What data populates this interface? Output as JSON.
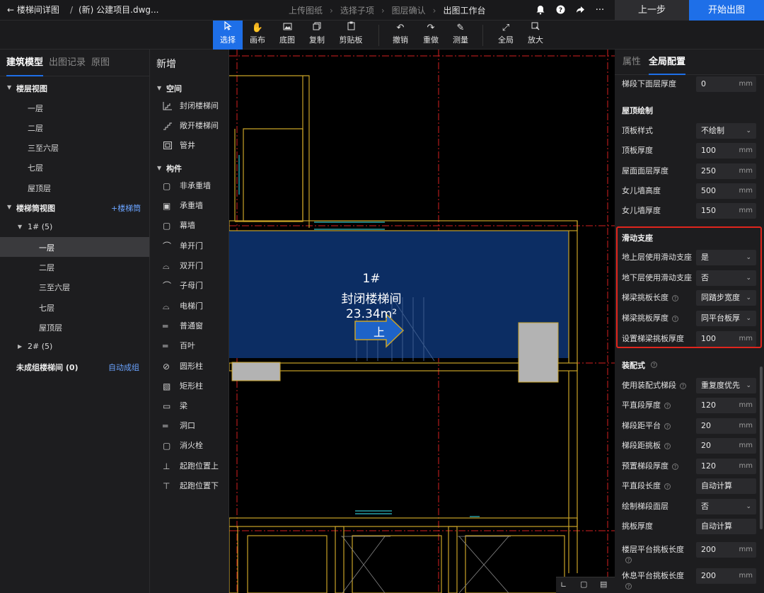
{
  "header": {
    "back_label": "楼梯间详图",
    "file_name": "(新) 公建项目.dwg...",
    "steps": [
      "上传图纸",
      "选择子项",
      "图层确认",
      "出图工作台"
    ],
    "prev_button": "上一步",
    "start_button": "开始出图"
  },
  "toolbar": {
    "tools": [
      {
        "label": "选择",
        "icon": "select-cursor-icon",
        "active": true
      },
      {
        "label": "画布",
        "icon": "hand-icon"
      },
      {
        "label": "底图",
        "icon": "image-icon"
      },
      {
        "label": "复制",
        "icon": "copy-icon"
      },
      {
        "label": "剪贴板",
        "icon": "clipboard-icon"
      },
      {
        "label": "撤销",
        "icon": "undo-icon"
      },
      {
        "label": "重做",
        "icon": "redo-icon"
      },
      {
        "label": "测量",
        "icon": "measure-icon"
      },
      {
        "label": "全局",
        "icon": "fit-all-icon"
      },
      {
        "label": "放大",
        "icon": "zoom-in-icon"
      }
    ]
  },
  "left_panel": {
    "tabs": [
      "建筑模型",
      "出图记录",
      "原图"
    ],
    "floor_view_title": "楼层视图",
    "floors": [
      "一层",
      "二层",
      "三至六层",
      "七层",
      "屋顶层"
    ],
    "stair_view_title": "楼梯筒视图",
    "add_stair": "+楼梯筒",
    "stair1_label": "1# (5)",
    "stair1_floors": [
      "一层",
      "二层",
      "三至六层",
      "七层",
      "屋顶层"
    ],
    "stair2_label": "2# (5)",
    "ungrouped_label": "未成组楼梯间 (0)",
    "auto_group": "自动成组"
  },
  "palette": {
    "title": "新增",
    "space_title": "空间",
    "space_items": [
      "封闭楼梯间",
      "敞开楼梯间",
      "管井"
    ],
    "component_title": "构件",
    "component_items": [
      "非承重墙",
      "承重墙",
      "幕墙",
      "单开门",
      "双开门",
      "子母门",
      "电梯门",
      "普通窗",
      "百叶",
      "圆形柱",
      "矩形柱",
      "梁",
      "洞口",
      "消火栓",
      "起跑位置上",
      "起跑位置下"
    ]
  },
  "canvas": {
    "room_number": "1#",
    "room_name": "封闭楼梯间",
    "room_area": "23.34m²",
    "up_label": "上"
  },
  "right_panel": {
    "tabs": [
      "属性",
      "全局配置"
    ],
    "top_row": {
      "label": "梯段下面层厚度",
      "value": "0",
      "unit": "mm"
    },
    "roof_title": "屋顶绘制",
    "roof_rows": [
      {
        "label": "顶板样式",
        "value": "不绘制",
        "type": "select"
      },
      {
        "label": "顶板厚度",
        "value": "100",
        "unit": "mm"
      },
      {
        "label": "屋面面层厚度",
        "value": "250",
        "unit": "mm"
      },
      {
        "label": "女儿墙高度",
        "value": "500",
        "unit": "mm"
      },
      {
        "label": "女儿墙厚度",
        "value": "150",
        "unit": "mm"
      }
    ],
    "slide_title": "滑动支座",
    "slide_rows": [
      {
        "label": "地上层使用滑动支座",
        "value": "是",
        "type": "select"
      },
      {
        "label": "地下层使用滑动支座",
        "value": "否",
        "type": "select"
      },
      {
        "label": "梯梁挑板长度",
        "value": "同踏步宽度",
        "type": "select",
        "help": true
      },
      {
        "label": "梯梁挑板厚度",
        "value": "同平台板厚",
        "type": "select",
        "help": true
      },
      {
        "label": "设置梯梁挑板厚度",
        "value": "100",
        "unit": "mm"
      }
    ],
    "prefab_title": "装配式",
    "prefab_rows": [
      {
        "label": "使用装配式梯段",
        "value": "重复度优先",
        "type": "select",
        "help": true
      },
      {
        "label": "平直段厚度",
        "value": "120",
        "unit": "mm",
        "help": true
      },
      {
        "label": "梯段距平台",
        "value": "20",
        "unit": "mm",
        "help": true
      },
      {
        "label": "梯段距挑板",
        "value": "20",
        "unit": "mm",
        "help": true
      },
      {
        "label": "预置梯段厚度",
        "value": "120",
        "unit": "mm",
        "help": true
      },
      {
        "label": "平直段长度",
        "value": "自动计算",
        "help": true
      },
      {
        "label": "绘制梯段面层",
        "value": "否",
        "type": "select"
      },
      {
        "label": "挑板厚度",
        "value": "自动计算"
      },
      {
        "label": "楼层平台挑板长度",
        "value": "200",
        "unit": "mm",
        "help": true
      },
      {
        "label": "休息平台挑板长度",
        "value": "200",
        "unit": "mm",
        "help": true
      }
    ]
  },
  "colors": {
    "accent": "#1e6fe8",
    "highlight": "#e0251d",
    "wall": "#c9a227",
    "grid": "#d42020",
    "room_fill": "#0c2d63"
  }
}
